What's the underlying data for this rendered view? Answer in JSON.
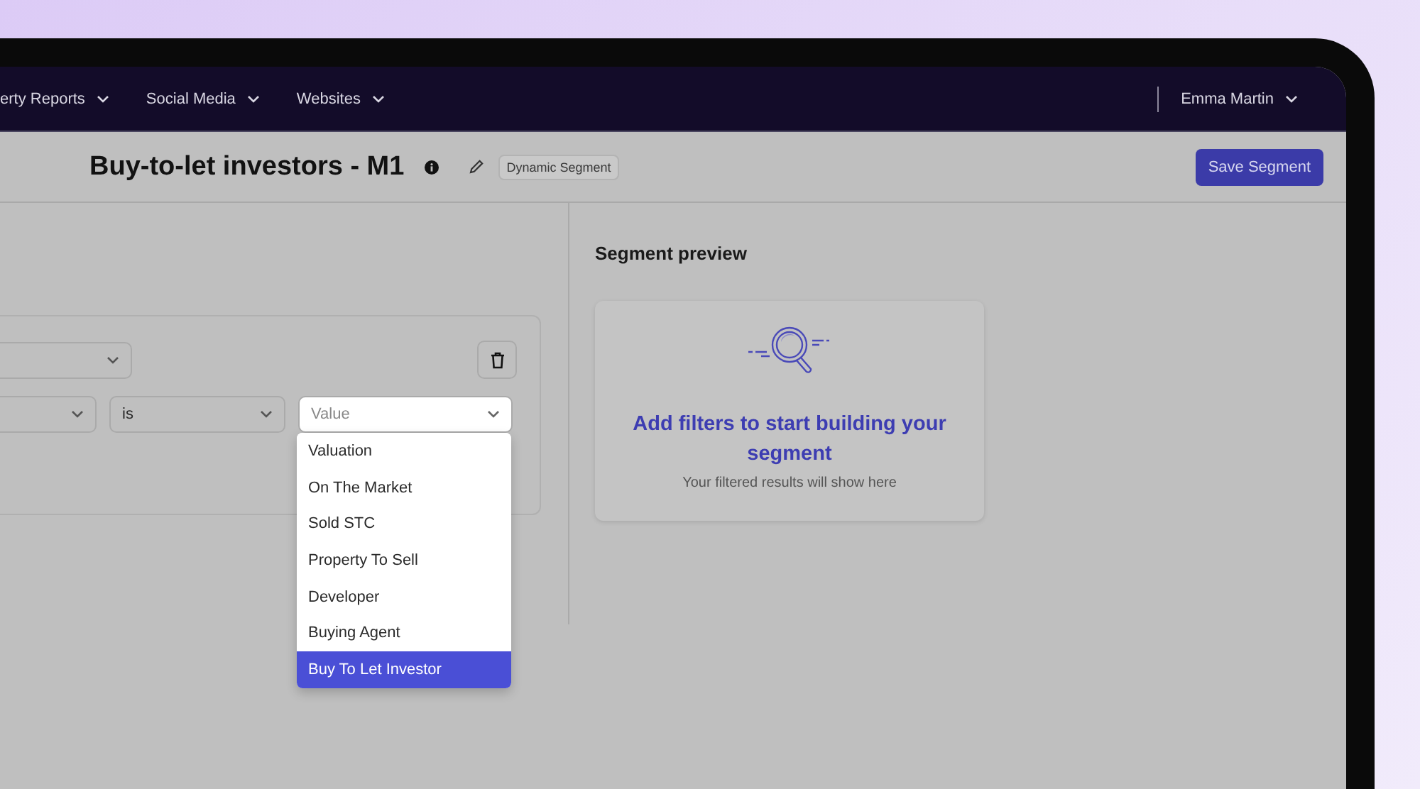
{
  "nav": {
    "items": [
      {
        "label": "erty Reports"
      },
      {
        "label": "Social Media"
      },
      {
        "label": "Websites"
      }
    ],
    "user": "Emma Martin"
  },
  "header": {
    "title": "Buy-to-let investors - M1",
    "badge": "Dynamic Segment",
    "save_button": "Save Segment"
  },
  "filter": {
    "operator": "is",
    "value_placeholder": "Value",
    "options": [
      {
        "label": "Valuation",
        "selected": false
      },
      {
        "label": "On The Market",
        "selected": false
      },
      {
        "label": "Sold STC",
        "selected": false
      },
      {
        "label": "Property To Sell",
        "selected": false
      },
      {
        "label": "Developer",
        "selected": false
      },
      {
        "label": "Buying Agent",
        "selected": false
      },
      {
        "label": "Buy To Let Investor",
        "selected": true
      }
    ]
  },
  "preview": {
    "title": "Segment preview",
    "heading": "Add filters to start building your segment",
    "subtext": "Your filtered results will show here"
  }
}
